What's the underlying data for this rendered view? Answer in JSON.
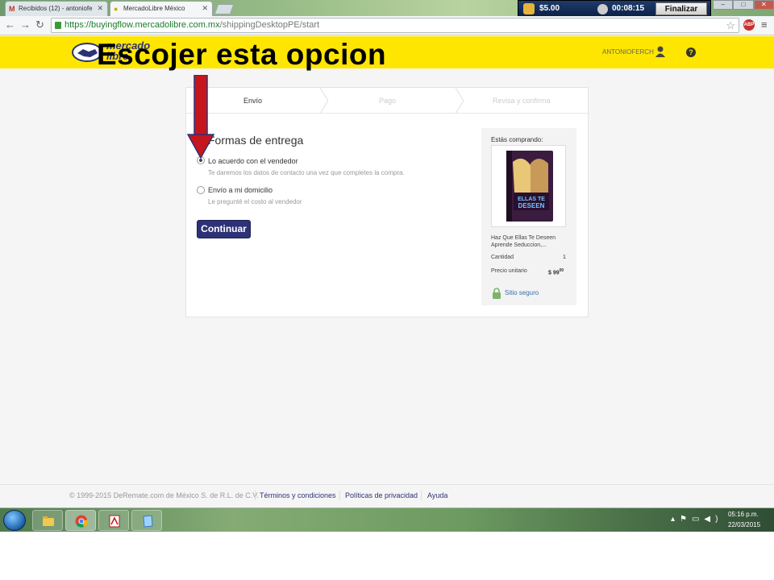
{
  "browser": {
    "tabs": [
      {
        "label": "Recibidos (12) - antoniofe",
        "favicon": "gmail-icon",
        "active": false
      },
      {
        "label": "MercadoLibre México",
        "favicon": "mercadolibre-icon",
        "active": true
      }
    ],
    "url_host": "https://buyingflow.mercadolibre.com.mx",
    "url_path": "/shippingDesktopPE/start",
    "abp_label": "ABP"
  },
  "recorder": {
    "price": "$5.00",
    "time": "00:08:15",
    "finish_label": "Finalizar"
  },
  "header": {
    "logo_line1": "mercado",
    "logo_line2": "libre",
    "username": "ANTONIOFERCH",
    "help": "?"
  },
  "annotation": "Escojer esta opcion",
  "steps": [
    {
      "label": "Envío",
      "active": true
    },
    {
      "label": "Pago",
      "active": false
    },
    {
      "label": "Revisa y confirma",
      "active": false
    }
  ],
  "delivery": {
    "title": "Formas de entrega",
    "options": [
      {
        "label": "Lo acuerdo con el vendedor",
        "desc": "Te daremos los datos de contacto una vez que completes la compra.",
        "selected": true
      },
      {
        "label": "Envío a mi domicilio",
        "desc": "Le pregunté el costo al vendedor",
        "selected": false
      }
    ],
    "continue_label": "Continuar"
  },
  "summary": {
    "title": "Estás comprando:",
    "product_name": "Haz Que Ellas Te Deseen Aprende Seduccion,...",
    "product_cover_text": "ELLAS TE DESEEN",
    "quantity_label": "Cantidad",
    "quantity_value": "1",
    "unit_price_label": "Precio unitario",
    "unit_price_value": "$ 99",
    "unit_price_cents": "00",
    "secure_label": "Sitio seguro"
  },
  "footer": {
    "copyright": "© 1999-2015 DeRemate.com de México S. de R.L. de C.V.",
    "links": [
      "Términos y condiciones",
      "Políticas de privacidad",
      "Ayuda"
    ]
  },
  "taskbar": {
    "clock_time": "05:16 p.m.",
    "clock_date": "22/03/2015"
  },
  "colors": {
    "brand_yellow": "#fee600",
    "brand_blue": "#2d3277",
    "annotation_arrow": "#c4161c"
  }
}
